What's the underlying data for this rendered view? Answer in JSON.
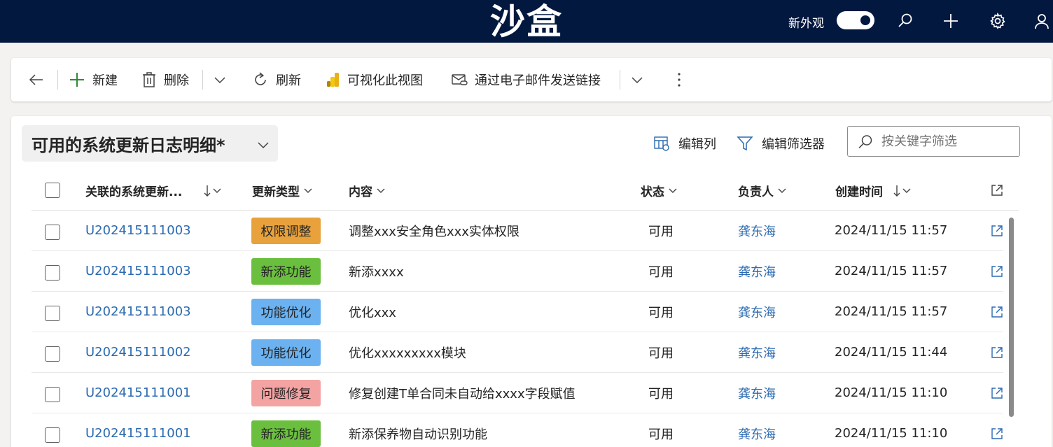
{
  "topbar": {
    "title": "沙盒",
    "new_look_label": "新外观",
    "new_look_on": true,
    "bg_color": "#03183f"
  },
  "commandbar": {
    "back_icon": "arrow-left-icon",
    "new_label": "新建",
    "delete_label": "删除",
    "refresh_label": "刷新",
    "visualize_label": "可视化此视图",
    "email_link_label": "通过电子邮件发送链接"
  },
  "view": {
    "title": "可用的系统更新日志明细*",
    "edit_columns_label": "编辑列",
    "edit_filters_label": "编辑筛选器",
    "search_placeholder": "按关键字筛选"
  },
  "grid": {
    "columns": {
      "ref": "关联的系统更新...",
      "type": "更新类型",
      "content": "内容",
      "status": "状态",
      "owner": "负责人",
      "created": "创建时间"
    },
    "rows": [
      {
        "ref": "U202415111003",
        "type": "权限调整",
        "content": "调整xxx安全角色xxx实体权限",
        "status": "可用",
        "owner": "龚东海",
        "created": "2024/11/15 11:57"
      },
      {
        "ref": "U202415111003",
        "type": "新添功能",
        "content": "新添xxxx",
        "status": "可用",
        "owner": "龚东海",
        "created": "2024/11/15 11:57"
      },
      {
        "ref": "U202415111003",
        "type": "功能优化",
        "content": "优化xxx",
        "status": "可用",
        "owner": "龚东海",
        "created": "2024/11/15 11:57"
      },
      {
        "ref": "U202415111002",
        "type": "功能优化",
        "content": "优化xxxxxxxxx模块",
        "status": "可用",
        "owner": "龚东海",
        "created": "2024/11/15 11:44"
      },
      {
        "ref": "U202415111001",
        "type": "问题修复",
        "content": "修复创建T单合同未自动给xxxx字段赋值",
        "status": "可用",
        "owner": "龚东海",
        "created": "2024/11/15 11:10"
      },
      {
        "ref": "U202415111001",
        "type": "新添功能",
        "content": "新添保养物自动识别功能",
        "status": "可用",
        "owner": "龚东海",
        "created": "2024/11/15 11:10"
      }
    ],
    "type_colors": {
      "权限调整": "#e9a23b",
      "新添功能": "#6bbf3f",
      "功能优化": "#6cb2f0",
      "问题修复": "#f4a3a3"
    },
    "link_color": "#2b6ab1"
  }
}
